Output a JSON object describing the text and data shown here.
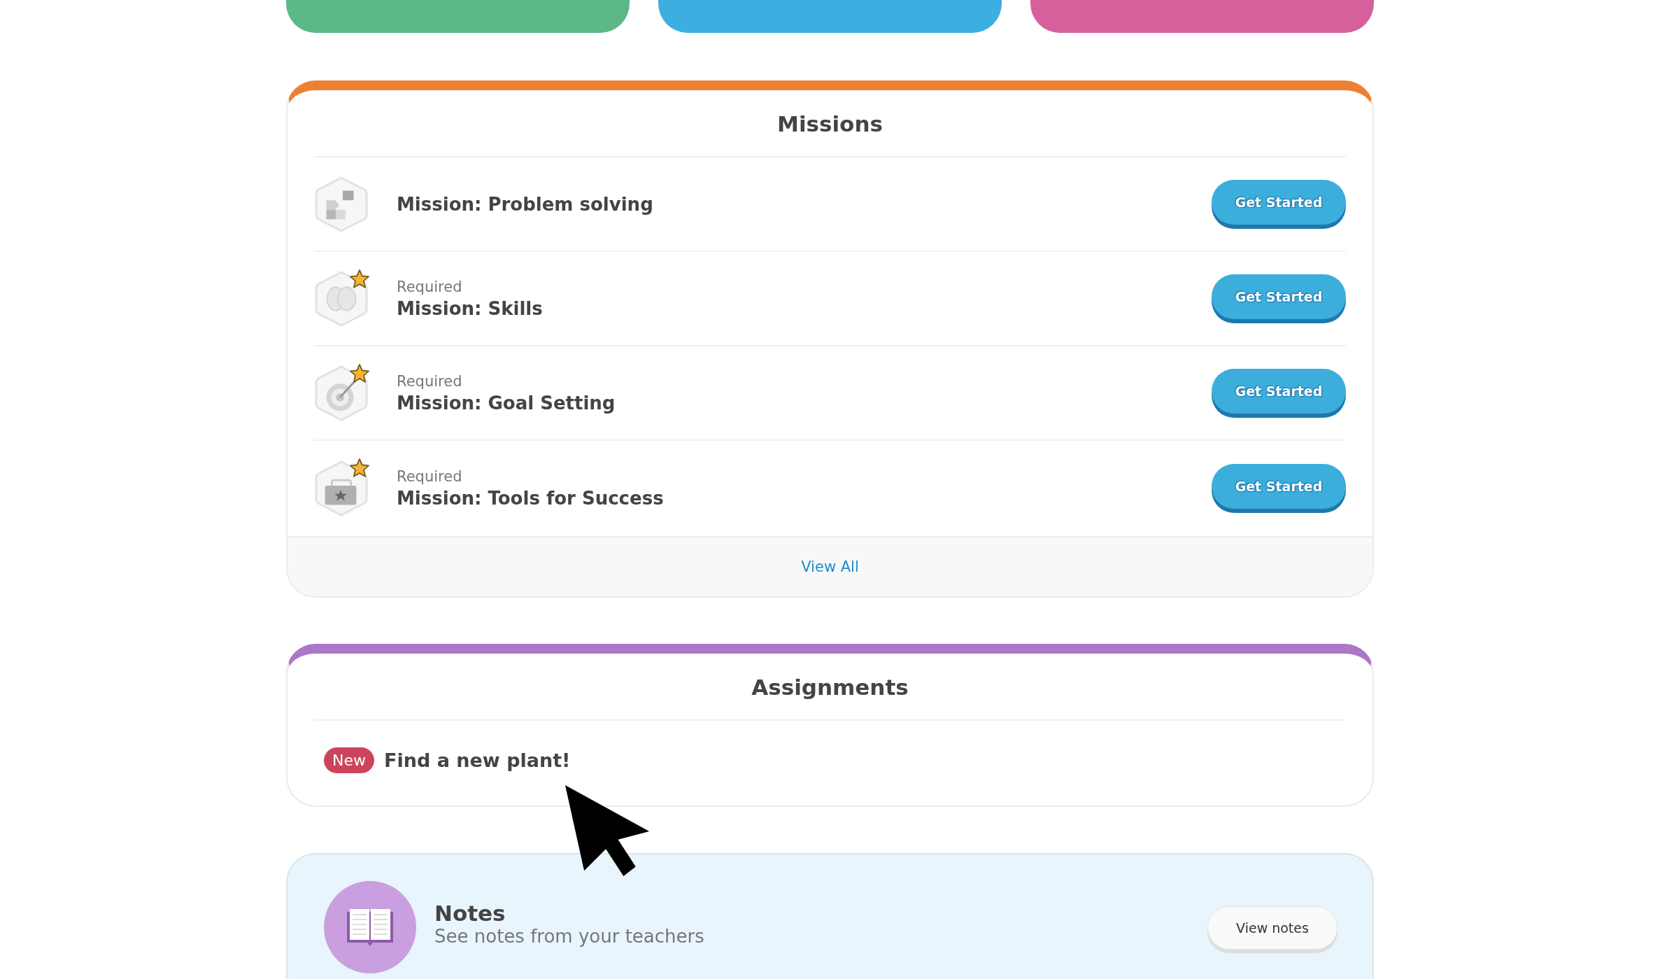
{
  "missions": {
    "title": "Missions",
    "items": [
      {
        "title": "Mission: Problem solving",
        "required": false,
        "button": "Get Started"
      },
      {
        "label": "Required",
        "title": "Mission: Skills",
        "required": true,
        "button": "Get Started"
      },
      {
        "label": "Required",
        "title": "Mission: Goal Setting",
        "required": true,
        "button": "Get Started"
      },
      {
        "label": "Required",
        "title": "Mission: Tools for Success",
        "required": true,
        "button": "Get Started"
      }
    ],
    "footer_link": "View All"
  },
  "assignments": {
    "title": "Assignments",
    "items": [
      {
        "badge": "New",
        "title": "Find a new plant!"
      }
    ]
  },
  "notes": {
    "title": "Notes",
    "subtitle": "See notes from your teachers",
    "button": "View notes"
  }
}
